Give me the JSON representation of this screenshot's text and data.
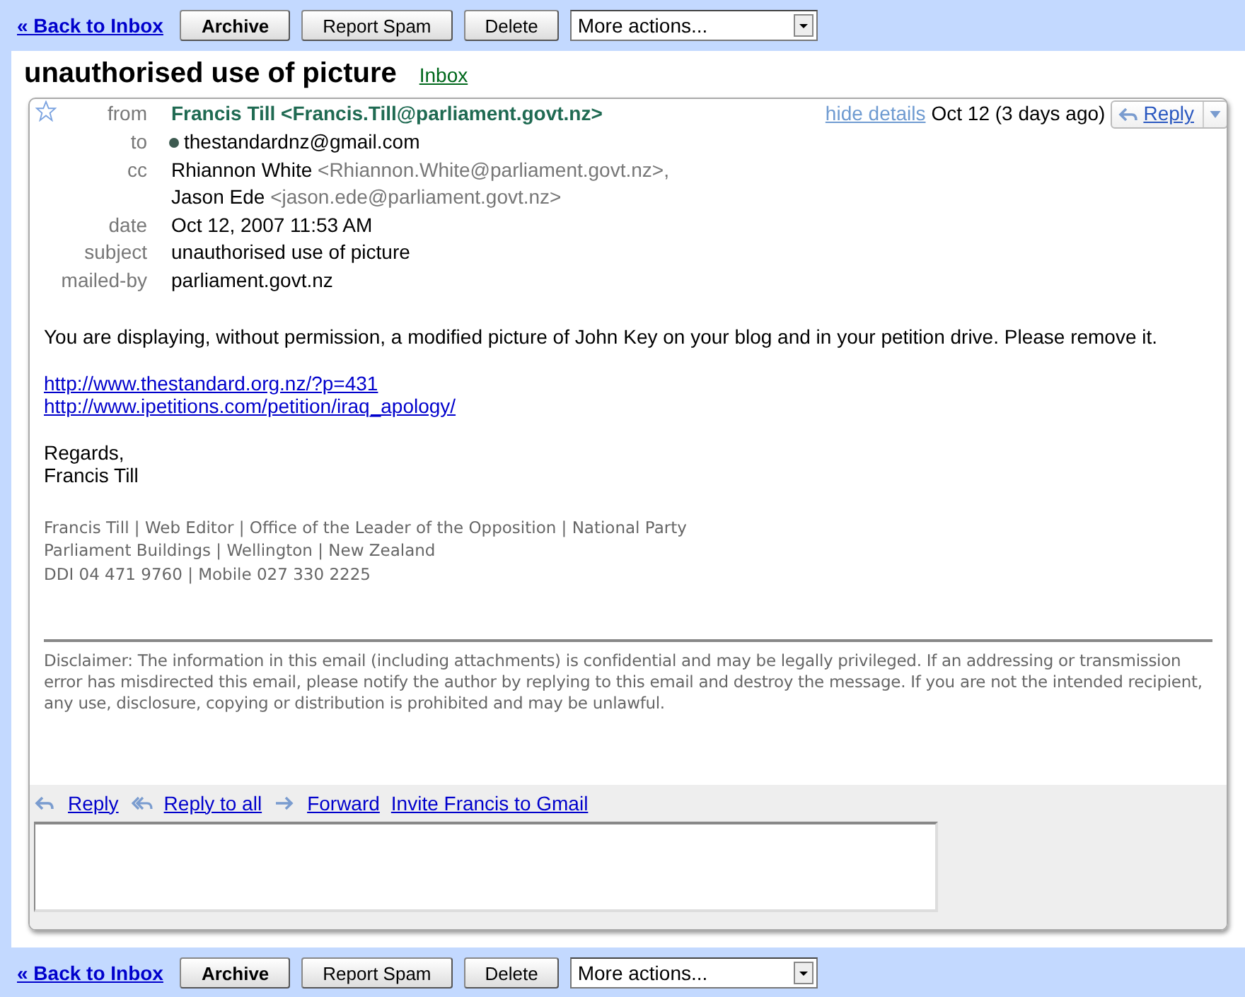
{
  "toolbar_top": {
    "back_link": "« Back to Inbox",
    "buttons": [
      {
        "label": "Archive",
        "kind": "primary"
      },
      {
        "label": "Report Spam",
        "kind": "plain"
      },
      {
        "label": "Delete",
        "kind": "plain"
      }
    ],
    "select": "More actions..."
  },
  "conversation": {
    "subject": "unauthorised use of picture",
    "label": "Inbox"
  },
  "message": {
    "starred": false,
    "header": [
      {
        "kind": "from",
        "label": "from",
        "name": "Francis Till",
        "address": "<Francis.Till@parliament.govt.nz>"
      },
      {
        "kind": "to",
        "label": "to",
        "value": "thestandardnz@gmail.com"
      },
      {
        "kind": "cc",
        "label": "cc",
        "people": [
          {
            "name": "Rhiannon White",
            "address": "<Rhiannon.White@parliament.govt.nz>,"
          },
          {
            "name": "Jason Ede",
            "address": "<jason.ede@parliament.govt.nz>"
          }
        ]
      },
      {
        "kind": "plain",
        "label": "date",
        "value": "Oct 12, 2007 11:53 AM"
      },
      {
        "kind": "plain",
        "label": "subject",
        "value": "unauthorised use of picture"
      },
      {
        "kind": "plain",
        "label": "mailed-by",
        "value": "parliament.govt.nz"
      }
    ],
    "hide_details": "hide details",
    "date_short": "Oct 12 (3 days ago)",
    "reply_button": "Reply",
    "body": [
      {
        "kind": "text",
        "lines": [
          "You are displaying, without permission, a modified picture of John Key on your blog and in your petition drive. Please remove it."
        ]
      },
      {
        "kind": "links",
        "lines": [
          "http://www.thestandard.org.nz/?p=431",
          "http://www.ipetitions.com/petition/iraq_apology/"
        ]
      },
      {
        "kind": "text",
        "lines": [
          "Regards,",
          "Francis Till"
        ]
      }
    ],
    "signature": [
      "Francis Till | Web Editor | Office of the Leader of the Opposition | National Party",
      "Parliament Buildings | Wellington | New Zealand",
      "DDI 04 471 9760 | Mobile 027 330 2225"
    ],
    "disclaimer": "Disclaimer: The information in this email (including attachments) is confidential and may be legally privileged. If an addressing or transmission error has misdirected this email, please notify the author by replying to this email and destroy the message. If you are not the intended recipient, any use, disclosure, copying or distribution is prohibited and may be unlawful.",
    "actions": [
      {
        "kind": "reply",
        "label": "Reply"
      },
      {
        "kind": "reply_all",
        "label": "Reply to all"
      },
      {
        "kind": "forward",
        "label": "Forward"
      },
      {
        "kind": "invite",
        "label": "Invite Francis to Gmail"
      }
    ]
  },
  "toolbar_bottom": {
    "back_link": "« Back to Inbox",
    "buttons": [
      {
        "label": "Archive",
        "kind": "primary"
      },
      {
        "label": "Report Spam",
        "kind": "plain"
      },
      {
        "label": "Delete",
        "kind": "plain"
      }
    ],
    "select": "More actions..."
  }
}
